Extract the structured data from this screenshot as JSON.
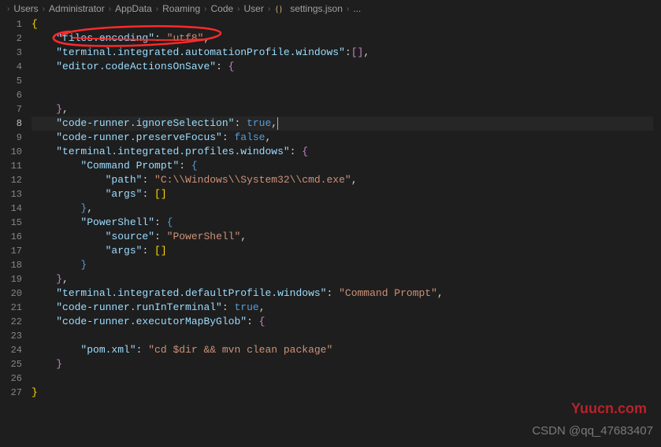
{
  "breadcrumb": {
    "segments": [
      "Users",
      "Administrator",
      "AppData",
      "Roaming",
      "Code",
      "User",
      "settings.json",
      "..."
    ],
    "file_index": 6,
    "file_icon": "braces-icon"
  },
  "code": {
    "lines": [
      {
        "n": 1,
        "indent": 0,
        "tokens": [
          {
            "t": "{",
            "c": "tok-brace-yellow"
          }
        ]
      },
      {
        "n": 2,
        "indent": 1,
        "tokens": [
          {
            "t": "\"files.encoding\"",
            "c": "tok-key"
          },
          {
            "t": ": ",
            "c": "tok-punct"
          },
          {
            "t": "\"utf8\"",
            "c": "tok-string"
          },
          {
            "t": ",",
            "c": "tok-punct"
          }
        ]
      },
      {
        "n": 3,
        "indent": 1,
        "tokens": [
          {
            "t": "\"terminal.integrated.automationProfile.windows\"",
            "c": "tok-key"
          },
          {
            "t": ":",
            "c": "tok-punct"
          },
          {
            "t": "[]",
            "c": "tok-brace-purple"
          },
          {
            "t": ",",
            "c": "tok-punct"
          }
        ]
      },
      {
        "n": 4,
        "indent": 1,
        "tokens": [
          {
            "t": "\"editor.codeActionsOnSave\"",
            "c": "tok-key"
          },
          {
            "t": ": ",
            "c": "tok-punct"
          },
          {
            "t": "{",
            "c": "tok-brace-purple"
          }
        ]
      },
      {
        "n": 5,
        "indent": 0,
        "tokens": []
      },
      {
        "n": 6,
        "indent": 0,
        "tokens": []
      },
      {
        "n": 7,
        "indent": 1,
        "tokens": [
          {
            "t": "}",
            "c": "tok-brace-purple"
          },
          {
            "t": ",",
            "c": "tok-punct"
          }
        ]
      },
      {
        "n": 8,
        "indent": 1,
        "current": true,
        "tokens": [
          {
            "t": "\"code-runner.ignoreSelection\"",
            "c": "tok-key"
          },
          {
            "t": ": ",
            "c": "tok-punct"
          },
          {
            "t": "true",
            "c": "tok-bool"
          },
          {
            "t": ",",
            "c": "tok-punct"
          },
          {
            "t": "",
            "cursor": true
          }
        ]
      },
      {
        "n": 9,
        "indent": 1,
        "tokens": [
          {
            "t": "\"code-runner.preserveFocus\"",
            "c": "tok-key"
          },
          {
            "t": ": ",
            "c": "tok-punct"
          },
          {
            "t": "false",
            "c": "tok-bool"
          },
          {
            "t": ",",
            "c": "tok-punct"
          }
        ]
      },
      {
        "n": 10,
        "indent": 1,
        "tokens": [
          {
            "t": "\"terminal.integrated.profiles.windows\"",
            "c": "tok-key"
          },
          {
            "t": ": ",
            "c": "tok-punct"
          },
          {
            "t": "{",
            "c": "tok-brace-purple"
          }
        ]
      },
      {
        "n": 11,
        "indent": 2,
        "tokens": [
          {
            "t": "\"Command Prompt\"",
            "c": "tok-key"
          },
          {
            "t": ": ",
            "c": "tok-punct"
          },
          {
            "t": "{",
            "c": "tok-brace-blue"
          }
        ]
      },
      {
        "n": 12,
        "indent": 3,
        "tokens": [
          {
            "t": "\"path\"",
            "c": "tok-key"
          },
          {
            "t": ": ",
            "c": "tok-punct"
          },
          {
            "t": "\"C:\\\\Windows\\\\System32\\\\cmd.exe\"",
            "c": "tok-string"
          },
          {
            "t": ",",
            "c": "tok-punct"
          }
        ]
      },
      {
        "n": 13,
        "indent": 3,
        "tokens": [
          {
            "t": "\"args\"",
            "c": "tok-key"
          },
          {
            "t": ": ",
            "c": "tok-punct"
          },
          {
            "t": "[]",
            "c": "tok-brace-yellow"
          }
        ]
      },
      {
        "n": 14,
        "indent": 2,
        "tokens": [
          {
            "t": "}",
            "c": "tok-brace-blue"
          },
          {
            "t": ",",
            "c": "tok-punct"
          }
        ]
      },
      {
        "n": 15,
        "indent": 2,
        "tokens": [
          {
            "t": "\"PowerShell\"",
            "c": "tok-key"
          },
          {
            "t": ": ",
            "c": "tok-punct"
          },
          {
            "t": "{",
            "c": "tok-brace-blue"
          }
        ]
      },
      {
        "n": 16,
        "indent": 3,
        "tokens": [
          {
            "t": "\"source\"",
            "c": "tok-key"
          },
          {
            "t": ": ",
            "c": "tok-punct"
          },
          {
            "t": "\"PowerShell\"",
            "c": "tok-string"
          },
          {
            "t": ",",
            "c": "tok-punct"
          }
        ]
      },
      {
        "n": 17,
        "indent": 3,
        "tokens": [
          {
            "t": "\"args\"",
            "c": "tok-key"
          },
          {
            "t": ": ",
            "c": "tok-punct"
          },
          {
            "t": "[]",
            "c": "tok-brace-yellow"
          }
        ]
      },
      {
        "n": 18,
        "indent": 2,
        "tokens": [
          {
            "t": "}",
            "c": "tok-brace-blue"
          }
        ]
      },
      {
        "n": 19,
        "indent": 1,
        "tokens": [
          {
            "t": "}",
            "c": "tok-brace-purple"
          },
          {
            "t": ",",
            "c": "tok-punct"
          }
        ]
      },
      {
        "n": 20,
        "indent": 1,
        "tokens": [
          {
            "t": "\"terminal.integrated.defaultProfile.windows\"",
            "c": "tok-key"
          },
          {
            "t": ": ",
            "c": "tok-punct"
          },
          {
            "t": "\"Command Prompt\"",
            "c": "tok-string"
          },
          {
            "t": ",",
            "c": "tok-punct"
          }
        ]
      },
      {
        "n": 21,
        "indent": 1,
        "tokens": [
          {
            "t": "\"code-runner.runInTerminal\"",
            "c": "tok-key"
          },
          {
            "t": ": ",
            "c": "tok-punct"
          },
          {
            "t": "true",
            "c": "tok-bool"
          },
          {
            "t": ",",
            "c": "tok-punct"
          }
        ]
      },
      {
        "n": 22,
        "indent": 1,
        "tokens": [
          {
            "t": "\"code-runner.executorMapByGlob\"",
            "c": "tok-key"
          },
          {
            "t": ": ",
            "c": "tok-punct"
          },
          {
            "t": "{",
            "c": "tok-brace-purple"
          }
        ]
      },
      {
        "n": 23,
        "indent": 0,
        "tokens": []
      },
      {
        "n": 24,
        "indent": 2,
        "tokens": [
          {
            "t": "\"pom.xml\"",
            "c": "tok-key"
          },
          {
            "t": ": ",
            "c": "tok-punct"
          },
          {
            "t": "\"cd $dir && mvn clean package\"",
            "c": "tok-string"
          }
        ]
      },
      {
        "n": 25,
        "indent": 1,
        "tokens": [
          {
            "t": "}",
            "c": "tok-brace-purple"
          }
        ]
      },
      {
        "n": 26,
        "indent": 0,
        "tokens": []
      },
      {
        "n": 27,
        "indent": 0,
        "tokens": [
          {
            "t": "}",
            "c": "tok-brace-yellow"
          }
        ]
      }
    ],
    "current_line": 8
  },
  "annotation": {
    "type": "hand-drawn-circle",
    "color": "#ff2a2a",
    "around_line": 2
  },
  "watermarks": {
    "wm1": "Yuucn.com",
    "wm2": "CSDN @qq_47683407"
  }
}
